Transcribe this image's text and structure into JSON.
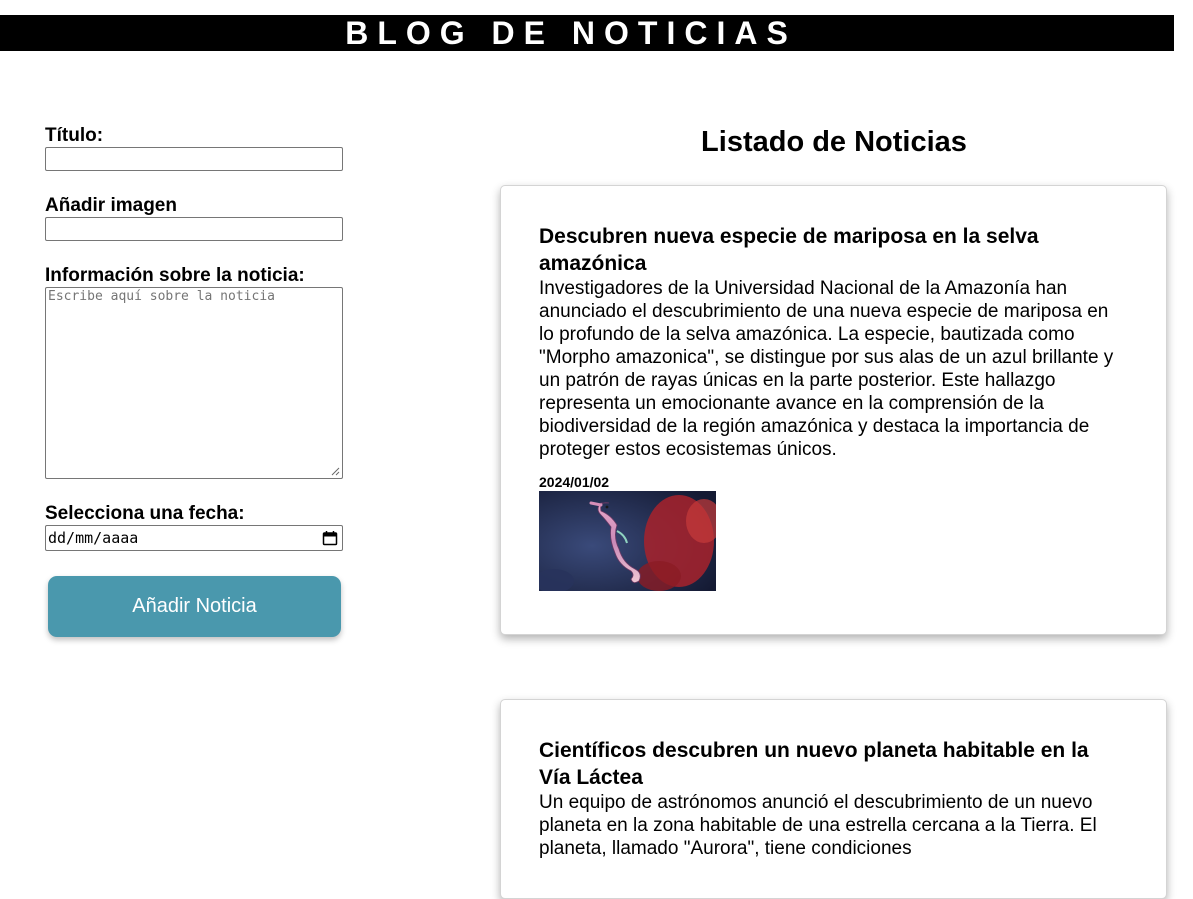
{
  "header": {
    "title": "BLOG DE NOTICIAS"
  },
  "form": {
    "title_label": "Título:",
    "title_value": "",
    "image_label": "Añadir imagen",
    "image_value": "",
    "info_label": "Información sobre la noticia:",
    "info_placeholder": "Escribe aquí sobre la noticia",
    "date_label": "Selecciona una fecha:",
    "date_placeholder": "dd/mm/aaaa",
    "submit_label": "Añadir Noticia"
  },
  "list": {
    "title": "Listado de Noticias",
    "items": [
      {
        "title": "Descubren nueva especie de mariposa en la selva amazónica",
        "body": "Investigadores de la Universidad Nacional de la Amazonía han anunciado el descubrimiento de una nueva especie de mariposa en lo profundo de la selva amazónica. La especie, bautizada como \"Morpho amazonica\", se distingue por sus alas de un azul brillante y un patrón de rayas únicas en la parte posterior. Este hallazgo representa un emocionante avance en la comprensión de la biodiversidad de la región amazónica y destaca la importancia de proteger estos ecosistemas únicos.",
        "date": "2024/01/02",
        "image": "seahorse-photo"
      },
      {
        "title": "Científicos descubren un nuevo planeta habitable en la Vía Láctea",
        "body": "Un equipo de astrónomos anunció el descubrimiento de un nuevo planeta en la zona habitable de una estrella cercana a la Tierra. El planeta, llamado \"Aurora\", tiene condiciones"
      }
    ]
  },
  "colors": {
    "header_bg": "#000000",
    "button_bg": "#4a98ad"
  }
}
